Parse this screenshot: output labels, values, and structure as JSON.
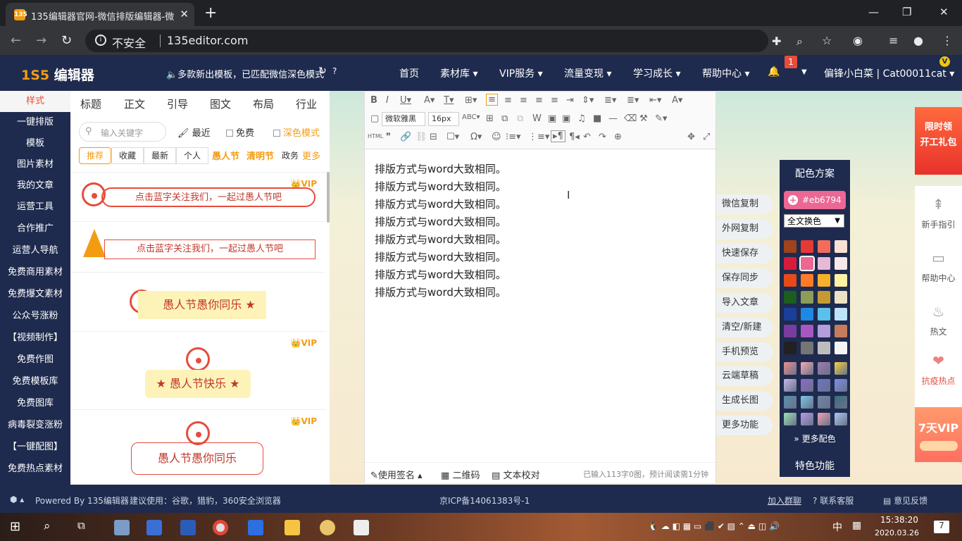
{
  "browser": {
    "tab_title": "135编辑器官网-微信排版编辑器-微",
    "tab_favicon": "135",
    "new_tab": "+",
    "security": "不安全",
    "url": "135editor.com",
    "min": "—",
    "restore": "❐",
    "close": "✕",
    "back": "←",
    "forward": "→",
    "reload": "↻"
  },
  "site": {
    "logo_mark": "1S5",
    "logo_text": "编辑器",
    "notice": "🔈多款新出模板，已匹配微信深色模式",
    "nav": [
      "首页",
      "素材库 ▾",
      "VIP服务 ▾",
      "流量变现 ▾",
      "学习成长 ▾",
      "帮助中心 ▾"
    ],
    "notif_count": "1",
    "vip_badge": "V",
    "user": "偏锋小白菜 | Cat00011cat ▾"
  },
  "sidebar": {
    "items": [
      "样式",
      "一键排版",
      "模板",
      "图片素材",
      "我的文章",
      "运营工具",
      "合作推广",
      "运营人导航",
      "免费商用素材",
      "免费爆文素材",
      "公众号涨粉",
      "【视频制作】",
      "免费作图",
      "免费模板库",
      "免费图库",
      "病毒裂变涨粉",
      "【一键配图】",
      "免费热点素材"
    ]
  },
  "panel": {
    "tabs": [
      "标题",
      "正文",
      "引导",
      "图文",
      "布局",
      "行业"
    ],
    "search_placeholder": "输入关键字",
    "recent": "最近",
    "free": "免费",
    "dark": "深色模式",
    "subtabs": [
      "推荐",
      "收藏",
      "最新",
      "个人"
    ],
    "tags": [
      "愚人节",
      "清明节",
      "政务",
      "更多"
    ],
    "vip": "VIP",
    "templates": [
      "点击蓝字关注我们，一起过愚人节吧",
      "点击蓝字关注我们，一起过愚人节吧",
      "愚人节愚你同乐",
      "愚人节快乐",
      "愚人节愚你同乐"
    ]
  },
  "editor": {
    "font": "微软雅黑",
    "size": "16px",
    "lines": [
      "排版方式与word大致相同。",
      "排版方式与word大致相同。",
      "排版方式与word大致相同。",
      "排版方式与word大致相同。",
      "排版方式与word大致相同。",
      "排版方式与word大致相同。",
      "排版方式与word大致相同。",
      "排版方式与word大致相同。"
    ],
    "footer_sign": "使用签名 ▴",
    "footer_qr": "二维码",
    "footer_check": "文本校对",
    "footer_stat": "已输入113字0图，预计阅读需1分钟"
  },
  "actions": [
    "微信复制",
    "外网复制",
    "快速保存",
    "保存同步",
    "导入文章",
    "清空/新建",
    "手机预览",
    "云端草稿",
    "生成长图",
    "更多功能"
  ],
  "color_panel": {
    "title": "配色方案",
    "current": "#eb6794",
    "select": "全文换色",
    "more": "更多配色",
    "special": "特色功能",
    "swatches": [
      "#a0421c",
      "#e53935",
      "#f26b5b",
      "#f9e0d4",
      "#d81b3c",
      "#eb6794",
      "#e6b9d4",
      "#f8e8e8",
      "#e64a19",
      "#ff7b29",
      "#f6b02c",
      "#fdf1a6",
      "#1b5e20",
      "#8d9d5a",
      "#c59a33",
      "#ece2c4",
      "#1a3f9b",
      "#1e88e5",
      "#5bc0eb",
      "#bde3f7",
      "#7b3ca0",
      "#a857c0",
      "#b39ddb",
      "#c67c5c",
      "#212121",
      "#757575",
      "#bdbdbd",
      "#f5f5f5"
    ],
    "gradients": [
      "#e88f8f",
      "#f7a8b0",
      "#a07ab0",
      "#f4d03f",
      "#c7b8e8",
      "#8e6ad0",
      "#6a74c9",
      "#7d8de8",
      "#5c8fb0",
      "#7ac7e8",
      "#6f86a6",
      "#3a6d80",
      "#9be0b0",
      "#b89ae8",
      "#f4a0b0",
      "#aac8f0"
    ]
  },
  "right_panel": {
    "promo_top": [
      "限时领",
      "开工礼包"
    ],
    "items": [
      "新手指引",
      "帮助中心",
      "热文",
      "抗疫热点"
    ],
    "icons": [
      "rocket-icon",
      "book-icon",
      "flame-icon",
      "heart-hands-icon"
    ],
    "promo_bottom": "7天VIP"
  },
  "site_footer": {
    "powered": "Powered By 135编辑器",
    "suggest": "建议使用：谷歌，猎豹，360安全浏览器",
    "icp": "京ICP备14061383号-1",
    "join": "加入群聊",
    "service": "联系客服",
    "feedback": "意见反馈"
  },
  "taskbar": {
    "ime": "中",
    "time": "15:38:20",
    "date": "2020.03.26",
    "notif": "7"
  }
}
